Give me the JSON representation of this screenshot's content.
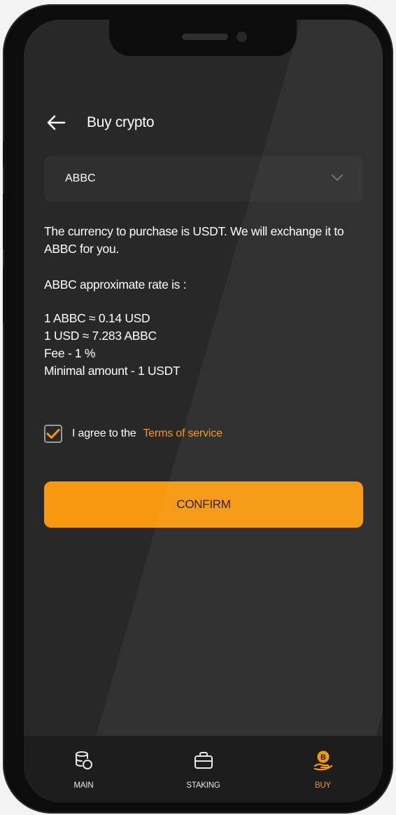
{
  "header": {
    "title": "Buy crypto",
    "back_icon": "arrow-left-icon"
  },
  "currency_select": {
    "value": "ABBC",
    "chevron_icon": "chevron-down-icon"
  },
  "info": {
    "description": "The currency to purchase is USDT. We will exchange it to ABBC for you.",
    "rate_title": "ABBC approximate rate is :",
    "rate_lines": [
      "1 ABBC ≈ 0.14 USD",
      "1 USD ≈ 7.283 ABBC",
      "Fee - 1 %",
      "Minimal amount - 1 USDT"
    ]
  },
  "agreement": {
    "checked": true,
    "label": "I agree to the",
    "terms_link": "Terms of service"
  },
  "confirm_button": {
    "label": "CONFIRM"
  },
  "nav": {
    "items": [
      {
        "label": "MAIN",
        "icon": "database-coins-icon",
        "active": false
      },
      {
        "label": "STAKING",
        "icon": "briefcase-icon",
        "active": false
      },
      {
        "label": "BUY",
        "icon": "bitcoin-hand-icon",
        "active": true
      }
    ]
  },
  "colors": {
    "accent": "#f7980f",
    "background": "#282828",
    "nav_background": "#1d1d1d"
  }
}
